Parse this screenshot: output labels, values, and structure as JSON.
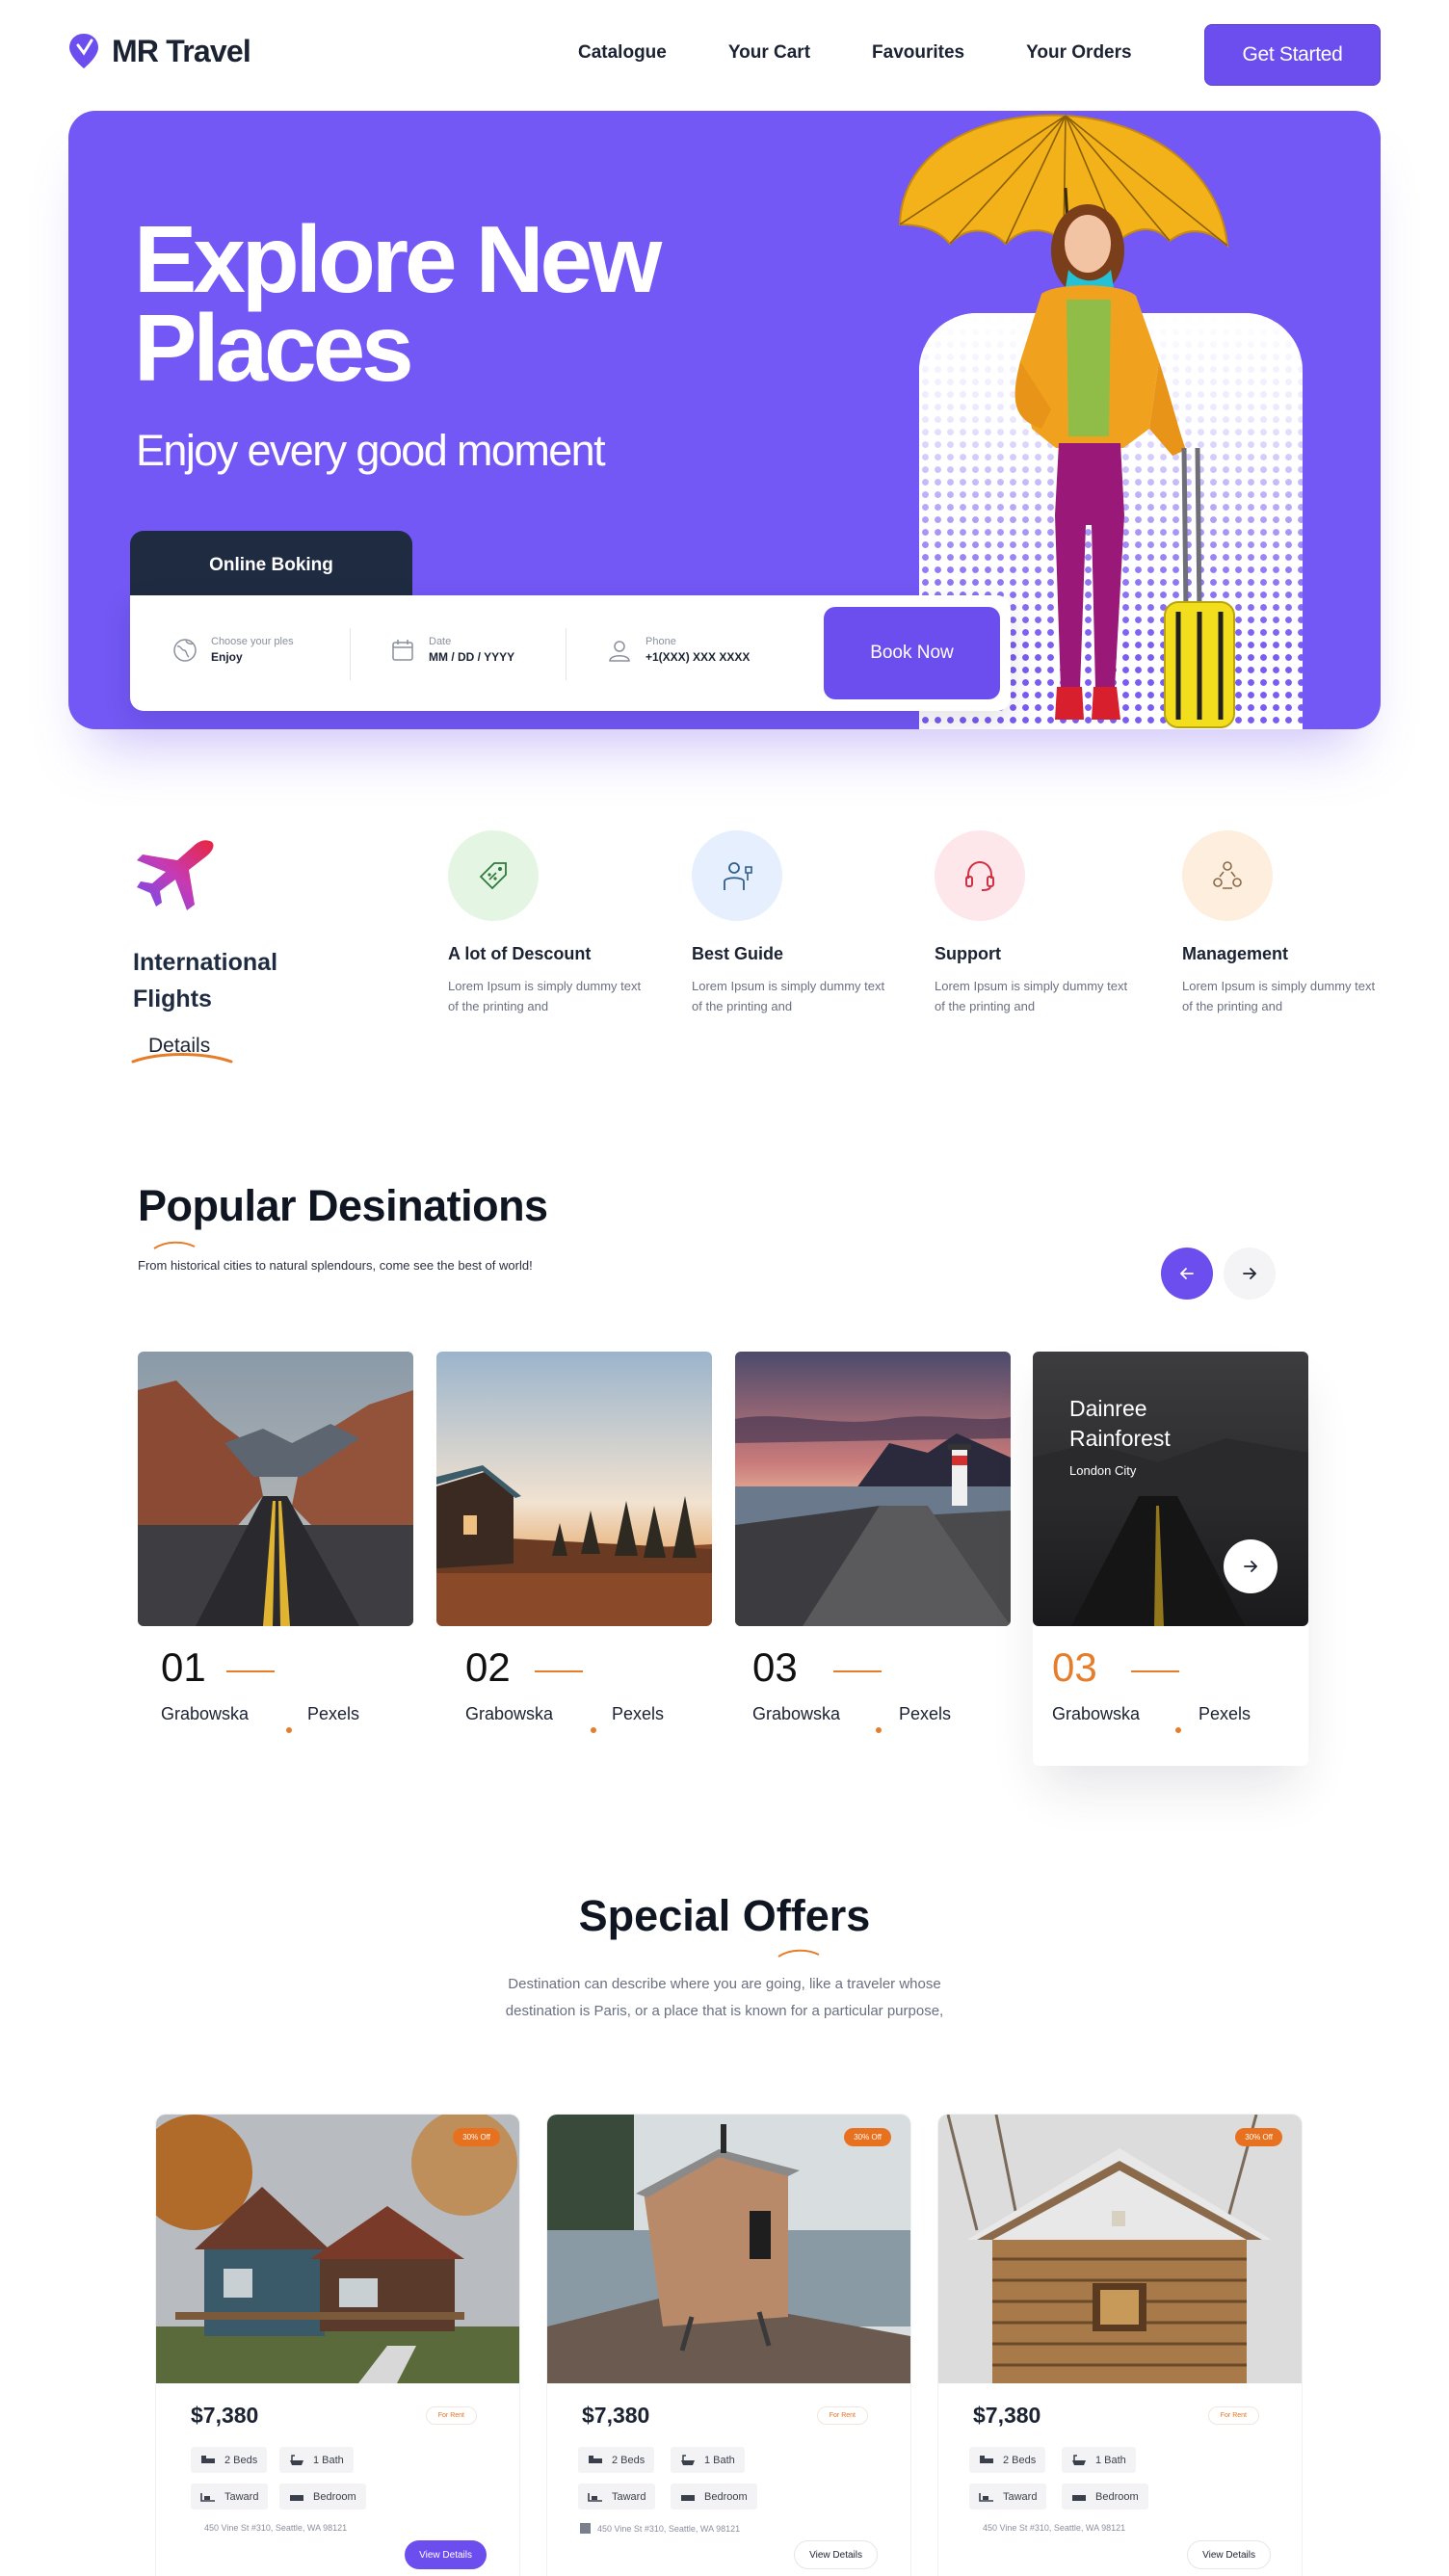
{
  "nav": {
    "brand": "MR Travel",
    "links": [
      "Catalogue",
      "Your Cart",
      "Favourites",
      "Your Orders"
    ],
    "cta": "Get Started"
  },
  "hero": {
    "title_line1": "Explore New",
    "title_line2": "Places",
    "subtitle": "Enjoy every good moment",
    "booking_tab": "Online Boking",
    "fields": [
      {
        "label": "Choose your ples",
        "value": "Enjoy",
        "icon": "globe-icon"
      },
      {
        "label": "Date",
        "value": "MM / DD /  YYYY",
        "icon": "calendar-icon"
      },
      {
        "label": "Phone",
        "value": "+1(XXX) XXX XXXX",
        "icon": "user-icon"
      }
    ],
    "book_button": "Book Now"
  },
  "features": {
    "intl_title_line1": "International",
    "intl_title_line2": "Flights",
    "details_link": "Details",
    "items": [
      {
        "title": "A lot of Descount",
        "text": "Lorem Ipsum is simply dummy text of the printing and",
        "icon": "discount-tag-icon",
        "bg": "#e4f6e3"
      },
      {
        "title": "Best Guide",
        "text": "Lorem Ipsum is simply dummy text of the printing and",
        "icon": "guide-person-icon",
        "bg": "#e6effd"
      },
      {
        "title": "Support",
        "text": "Lorem Ipsum is simply dummy text of the printing and",
        "icon": "headset-icon",
        "bg": "#fde7ea"
      },
      {
        "title": "Management",
        "text": "Lorem Ipsum is simply dummy text of the printing and",
        "icon": "team-icon",
        "bg": "#fdeede"
      }
    ]
  },
  "popular": {
    "title": "Popular Desinations",
    "subtitle": "From historical cities to natural splendours, come see the best of world!",
    "cards": [
      {
        "num": "01",
        "left": "Grabowska",
        "right": "Pexels"
      },
      {
        "num": "02",
        "left": "Grabowska",
        "right": "Pexels"
      },
      {
        "num": "03",
        "left": "Grabowska",
        "right": "Pexels"
      },
      {
        "num": "03",
        "left": "Grabowska",
        "right": "Pexels",
        "overlay_title_line1": "Dainree",
        "overlay_title_line2": "Rainforest",
        "overlay_sub": "London City"
      }
    ]
  },
  "offers": {
    "title": "Special Offers",
    "text_line1": "Destination can describe where you are going, like a traveler whose",
    "text_line2": "destination is Paris, or a place that is known for a particular purpose,",
    "cards": [
      {
        "badge": "30% Off",
        "price": "$7,380",
        "tag": "For Rent",
        "beds": "2 Beds",
        "bath": "1 Bath",
        "area": "Taward",
        "room": "Bedroom",
        "address": "450 Vine St #310, Seattle, WA 98121",
        "button": "View Details",
        "primary": true
      },
      {
        "badge": "30% Off",
        "price": "$7,380",
        "tag": "For Rent",
        "beds": "2 Beds",
        "bath": "1 Bath",
        "area": "Taward",
        "room": "Bedroom",
        "address": "450 Vine St #310, Seattle, WA 98121",
        "button": "View Details",
        "primary": false
      },
      {
        "badge": "30% Off",
        "price": "$7,380",
        "tag": "For Rent",
        "beds": "2 Beds",
        "bath": "1 Bath",
        "area": "Taward",
        "room": "Bedroom",
        "address": "450 Vine St #310, Seattle, WA 98121",
        "button": "View Details",
        "primary": false
      }
    ]
  },
  "colors": {
    "accent": "#6c4eef",
    "orange": "#e67d2b",
    "dark": "#1f2b41"
  }
}
